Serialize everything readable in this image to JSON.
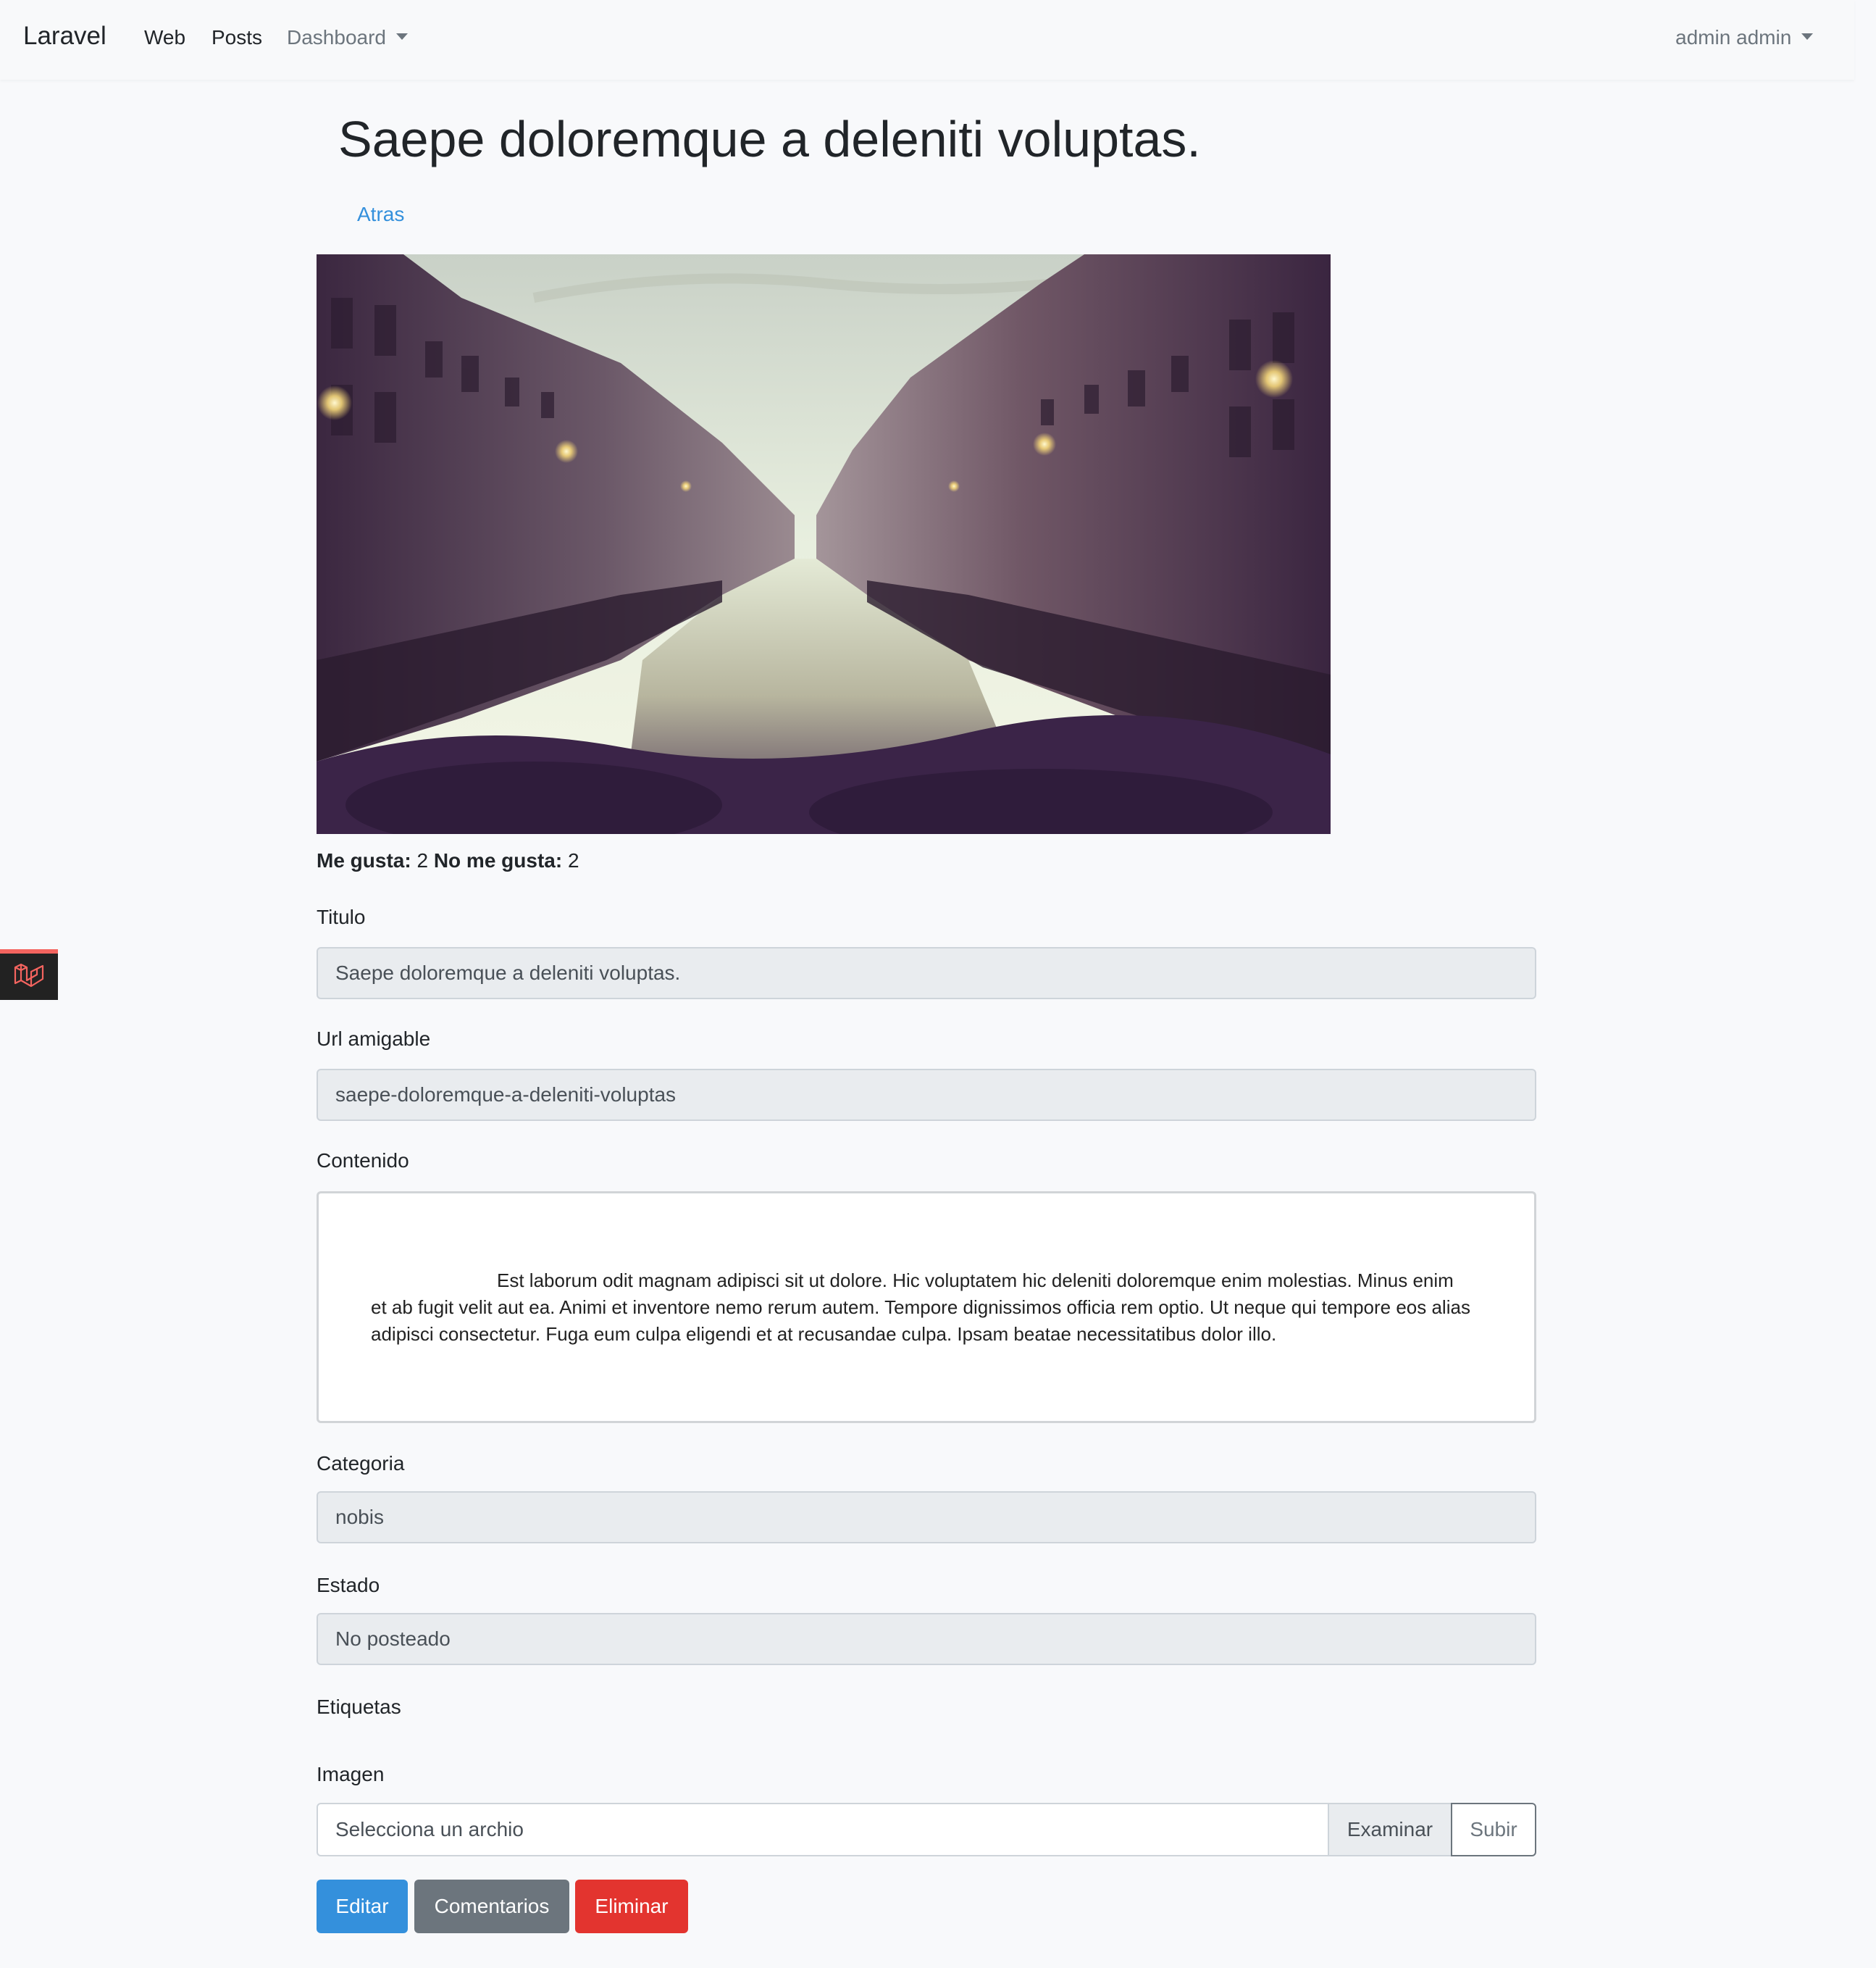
{
  "navbar": {
    "brand": "Laravel",
    "links": [
      "Web",
      "Posts"
    ],
    "dropdown": "Dashboard",
    "user": "admin admin"
  },
  "page": {
    "title": "Saepe doloremque a deleniti voluptas.",
    "back_link": "Atras"
  },
  "reactions": {
    "likes_label": "Me gusta:",
    "likes": "2",
    "dislikes_label": "No me gusta:",
    "dislikes": "2"
  },
  "form": {
    "title_label": "Titulo",
    "title_value": "Saepe doloremque a deleniti voluptas.",
    "slug_label": "Url amigable",
    "slug_value": "saepe-doloremque-a-deleniti-voluptas",
    "content_label": "Contenido",
    "content_value": "Est laborum odit magnam adipisci sit ut dolore. Hic voluptatem hic deleniti doloremque enim molestias. Minus enim et ab fugit velit aut ea. Animi et inventore nemo rerum autem. Tempore dignissimos officia rem optio. Ut neque qui tempore eos alias adipisci consectetur. Fuga eum culpa eligendi et at recusandae culpa. Ipsam beatae necessitatibus dolor illo.",
    "category_label": "Categoria",
    "category_value": "nobis",
    "status_label": "Estado",
    "status_value": "No posteado",
    "tags_label": "Etiquetas",
    "image_label": "Imagen",
    "file_placeholder": "Selecciona un archio",
    "browse_label": "Examinar",
    "upload_label": "Subir"
  },
  "actions": {
    "edit": "Editar",
    "comments": "Comentarios",
    "delete": "Eliminar"
  },
  "colors": {
    "primary": "#3490dc",
    "secondary": "#6c757d",
    "danger": "#e3342f"
  },
  "icons": {
    "debugbar": "laravel-logo-icon",
    "dropdown": "caret-down-icon"
  }
}
